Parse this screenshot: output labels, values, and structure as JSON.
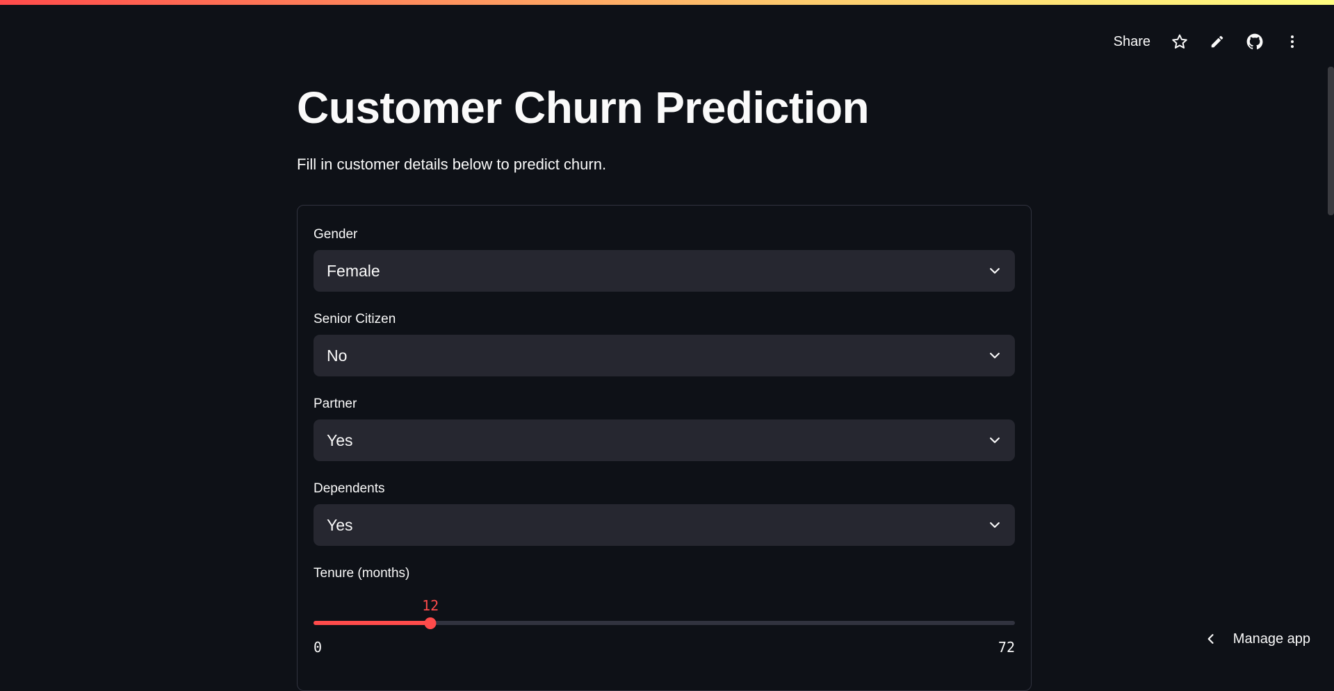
{
  "colors": {
    "background": "#0e1117",
    "input_bg": "#262730",
    "accent": "#ff4b4b",
    "border": "#31333f"
  },
  "toolbar": {
    "share_label": "Share",
    "icons": [
      "star-icon",
      "pencil-icon",
      "github-icon",
      "more-vertical-icon"
    ]
  },
  "page": {
    "title": "Customer Churn Prediction",
    "subtitle": "Fill in customer details below to predict churn."
  },
  "form": {
    "fields": [
      {
        "label": "Gender",
        "value": "Female"
      },
      {
        "label": "Senior Citizen",
        "value": "No"
      },
      {
        "label": "Partner",
        "value": "Yes"
      },
      {
        "label": "Dependents",
        "value": "Yes"
      }
    ],
    "tenure": {
      "label": "Tenure (months)",
      "value": 12,
      "min": 0,
      "max": 72
    }
  },
  "footer": {
    "manage_app_label": "Manage app"
  }
}
